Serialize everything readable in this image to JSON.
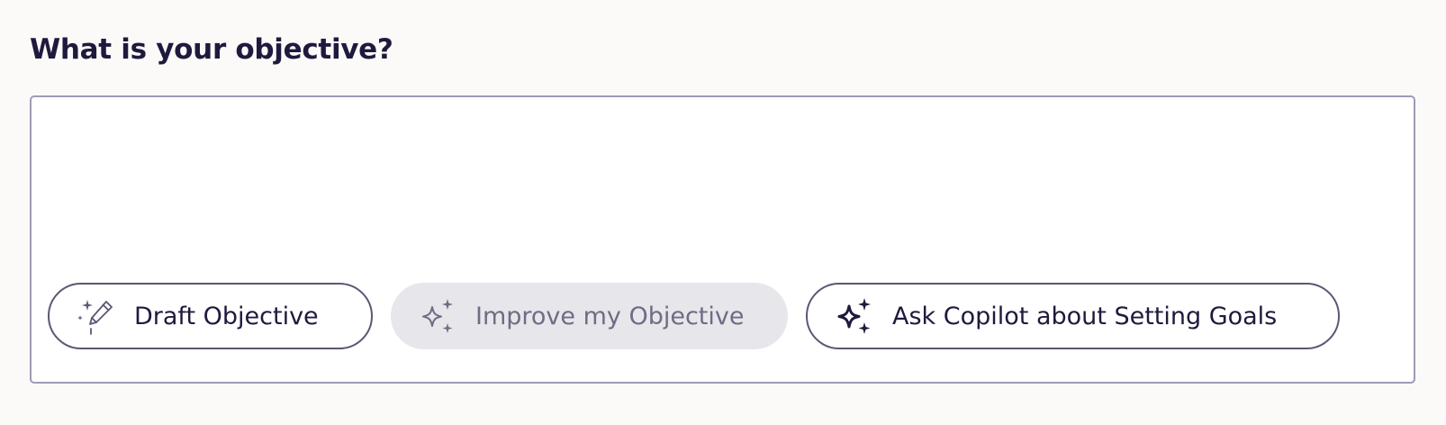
{
  "question": {
    "label": "What is your objective?"
  },
  "objective_input": {
    "value": ""
  },
  "actions": {
    "draft_label": "Draft Objective",
    "draft_icon": "sparkle-pencil-icon",
    "improve_label": "Improve my Objective",
    "improve_icon": "sparkles-icon",
    "ask_label": "Ask Copilot about Setting Goals",
    "ask_icon": "sparkles-icon"
  },
  "colors": {
    "text": "#1f1a3d",
    "border": "#9e9bb5",
    "pill_border": "#5b5775",
    "disabled_bg": "#e7e6ea",
    "disabled_text": "#6f6c85",
    "background": "#fbfaf9"
  }
}
